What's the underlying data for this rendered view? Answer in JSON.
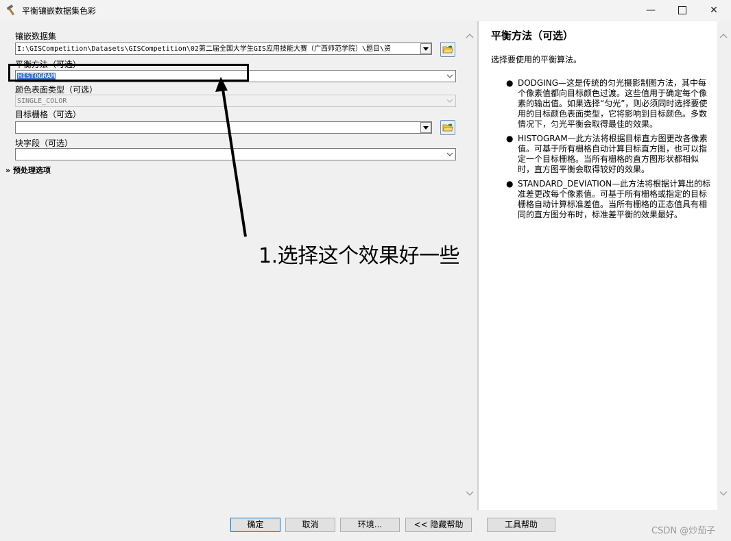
{
  "window": {
    "title": "平衡镶嵌数据集色彩",
    "icon": "hammer-icon",
    "controls": [
      "minimize-icon",
      "maximize-icon",
      "close-icon"
    ]
  },
  "form": {
    "mosaic_label": "镶嵌数据集",
    "mosaic_value": "I:\\GISCompetition\\Datasets\\GISCompetition\\02第二届全国大学生GIS应用技能大赛（广西师范学院）\\题目\\资",
    "method_label": "平衡方法（可选）",
    "method_value": "HISTOGRAM",
    "color_surface_label": "颜色表面类型（可选）",
    "color_surface_value": "SINGLE_COLOR",
    "target_raster_label": "目标栅格（可选）",
    "target_raster_value": "",
    "block_field_label": "块字段（可选）",
    "block_field_value": "",
    "preprocess_label": "预处理选项"
  },
  "annotation": {
    "text": "1.选择这个效果好一些"
  },
  "help": {
    "title": "平衡方法（可选）",
    "intro": "选择要使用的平衡算法。",
    "items": [
      "DODGING—这是传统的匀光摄影制图方法，其中每个像素值都向目标颜色过渡。这些值用于确定每个像素的输出值。如果选择“匀光”，则必须同时选择要使用的目标颜色表面类型，它将影响到目标颜色。多数情况下，匀光平衡会取得最佳的效果。",
      "HISTOGRAM—此方法将根据目标直方图更改各像素值。可基于所有栅格自动计算目标直方图，也可以指定一个目标栅格。当所有栅格的直方图形状都相似时，直方图平衡会取得较好的效果。",
      "STANDARD_DEVIATION—此方法将根据计算出的标准差更改每个像素值。可基于所有栅格或指定的目标栅格自动计算标准差值。当所有栅格的正态值具有相同的直方图分布时，标准差平衡的效果最好。"
    ]
  },
  "buttons": {
    "ok": "确定",
    "cancel": "取消",
    "environments": "环境...",
    "hide_help": "<< 隐藏帮助",
    "tool_help": "工具帮助"
  },
  "watermark": "CSDN @炒茄子"
}
